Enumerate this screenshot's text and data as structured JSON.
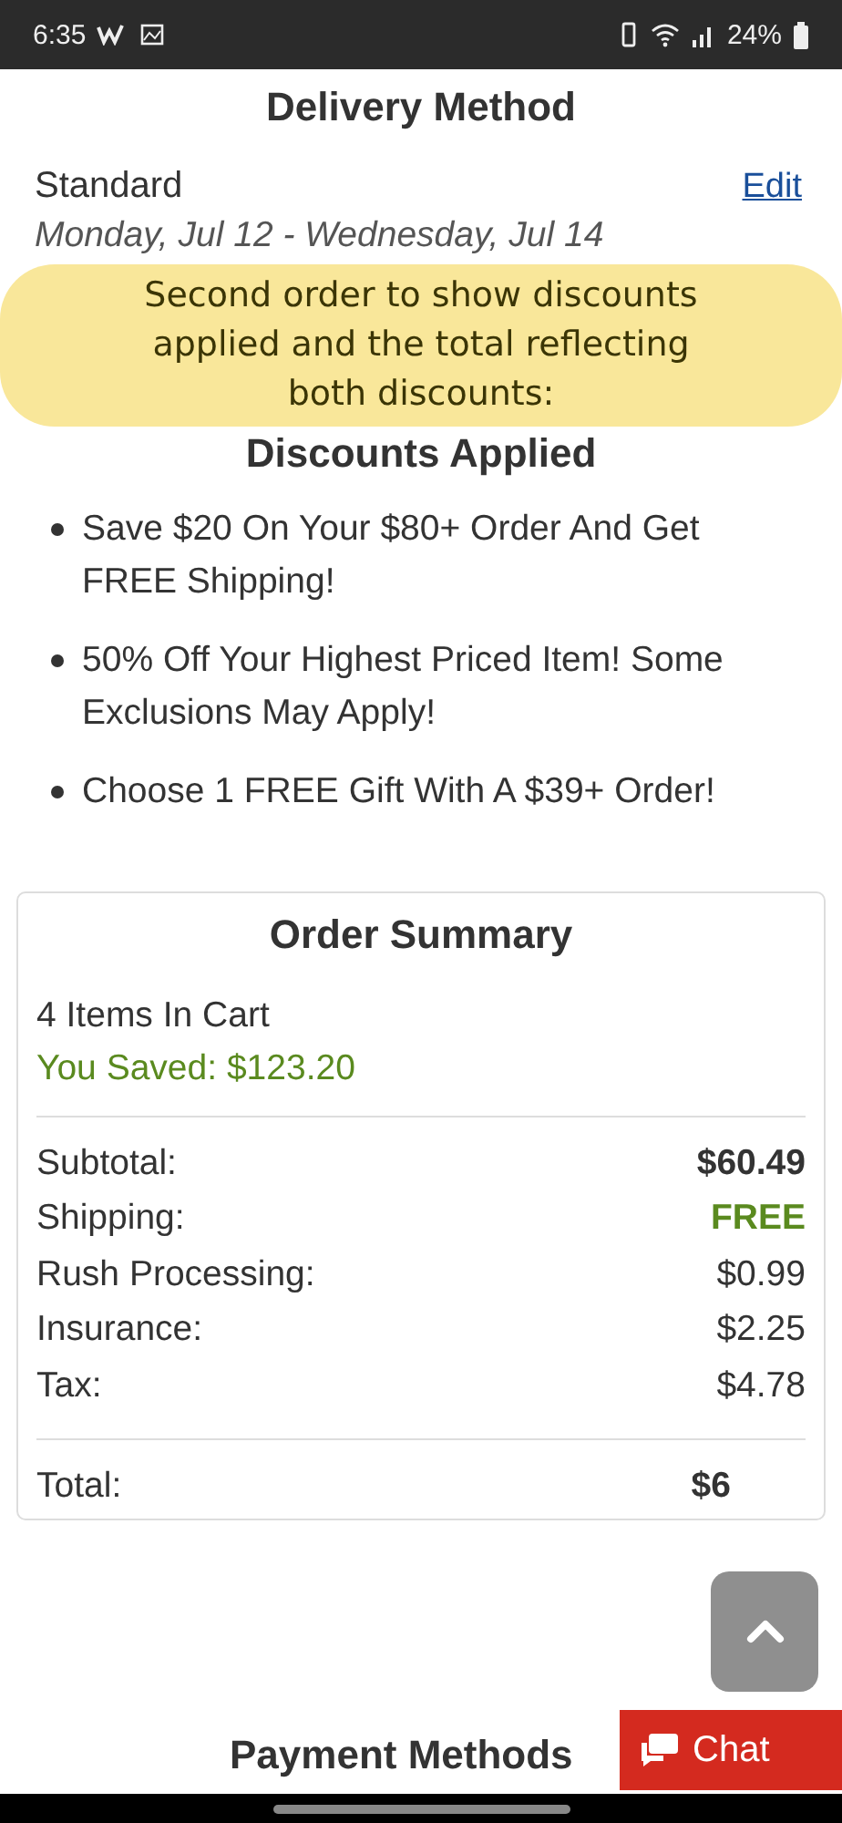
{
  "status_bar": {
    "time": "6:35",
    "battery": "24%"
  },
  "delivery": {
    "title": "Delivery Method",
    "method": "Standard",
    "edit": "Edit",
    "dates": "Monday, Jul 12 - Wednesday, Jul 14"
  },
  "annotation": "Second order to show discounts applied and the total reflecting both discounts:",
  "discounts": {
    "title": "Discounts Applied",
    "items": [
      "Save $20 On Your $80+ Order And Get FREE Shipping!",
      "50% Off Your Highest Priced Item! Some Exclusions May Apply!",
      "Choose 1 FREE Gift With A $39+ Order!"
    ]
  },
  "order_summary": {
    "title": "Order Summary",
    "items_in_cart": "4 Items In Cart",
    "saved": "You Saved: $123.20",
    "lines": [
      {
        "label": "Subtotal:",
        "value": "$60.49",
        "kind": "bold"
      },
      {
        "label": "Shipping:",
        "value": "FREE",
        "kind": "free"
      },
      {
        "label": "Rush Processing:",
        "value": "$0.99",
        "kind": "plain"
      },
      {
        "label": "Insurance:",
        "value": "$2.25",
        "kind": "plain"
      },
      {
        "label": "Tax:",
        "value": "$4.78",
        "kind": "plain"
      }
    ],
    "total_label": "Total:",
    "total_value": "$6"
  },
  "payment_title": "Payment Methods",
  "chat": "Chat"
}
